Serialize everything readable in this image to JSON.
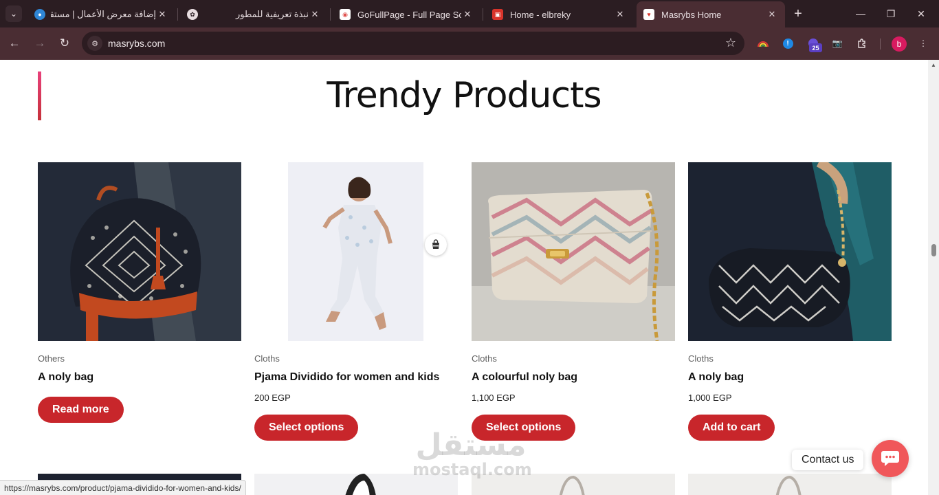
{
  "browser": {
    "tabs": [
      {
        "title": "إضافة معرض الأعمال | مستقل",
        "favicon": "mostaql-icon"
      },
      {
        "title": "نبذة تعريفية للمطور",
        "favicon": "openai-icon"
      },
      {
        "title": "GoFullPage - Full Page Scree",
        "favicon": "gofullpage-icon"
      },
      {
        "title": "Home - elbreky",
        "favicon": "elbreky-icon"
      },
      {
        "title": "Masrybs Home",
        "favicon": "masrybs-icon",
        "active": true
      }
    ],
    "url": "masrybs.com",
    "extension_badge": "25",
    "profile_initial": "b"
  },
  "page": {
    "section_title": "Trendy Products",
    "products": [
      {
        "category": "Others",
        "name": "A noly bag",
        "price": "",
        "button": "Read more"
      },
      {
        "category": "Cloths",
        "name": "Pjama Dividido for women and kids",
        "price": "200 EGP",
        "button": "Select options"
      },
      {
        "category": "Cloths",
        "name": "A colourful noly bag",
        "price": "1,100 EGP",
        "button": "Select options"
      },
      {
        "category": "Cloths",
        "name": "A noly bag",
        "price": "1,000 EGP",
        "button": "Add to cart"
      }
    ],
    "contact_label": "Contact us",
    "watermark": {
      "arabic": "مستقل",
      "latin": "mostaql.com"
    }
  },
  "status_bar": {
    "url": "https://masrybs.com/product/pjama-dividido-for-women-and-kids/"
  },
  "colors": {
    "button": "#c8262b",
    "chat": "#f0575a",
    "accent": "#e8417b",
    "chrome_dark": "#2b1d22",
    "chrome_toolbar": "#4a2d33"
  }
}
